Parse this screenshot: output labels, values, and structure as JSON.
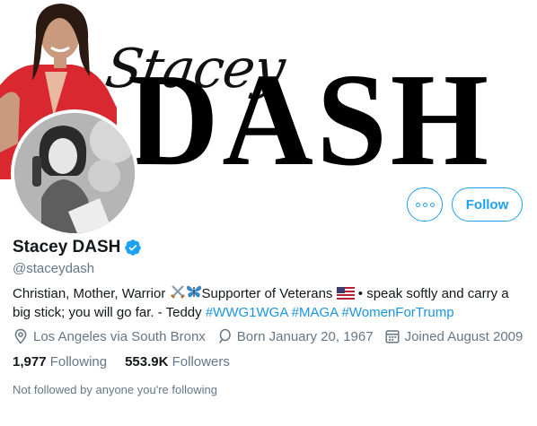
{
  "banner": {
    "script_text": "Stacey",
    "title_text": "DASH"
  },
  "actions": {
    "more_icon": "more-horizontal-icon",
    "follow_label": "Follow",
    "accent_color": "#1da1f2"
  },
  "profile": {
    "display_name": "Stacey DASH",
    "verified_icon": "verified-badge-icon",
    "handle": "@staceydash",
    "bio": {
      "part1": "Christian, Mother, Warrior ",
      "part2": "Supporter of Veterans ",
      "part3": " • speak softly and carry a big stick; you will go far. - Teddy ",
      "hashtags": [
        "#WWG1WGA",
        "#MAGA",
        "#WomenForTrump"
      ]
    },
    "location": "Los Angeles via South Bronx",
    "born": "Born January 20, 1967",
    "joined": "Joined August 2009",
    "following_count": "1,977",
    "following_label": "Following",
    "followers_count": "553.9K",
    "followers_label": "Followers",
    "not_followed_text": "Not followed by anyone you're following"
  }
}
